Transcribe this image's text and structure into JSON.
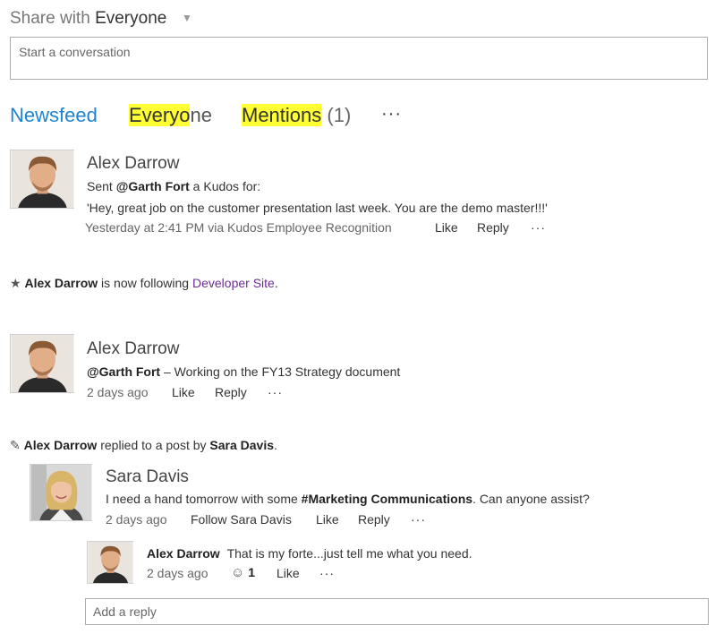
{
  "share": {
    "prefix": "Share with",
    "audience": "Everyone"
  },
  "composer": {
    "placeholder": "Start a conversation"
  },
  "tabs": {
    "newsfeed": "Newsfeed",
    "everyone_highlight": "Everyo",
    "everyone_rest": "ne",
    "mentions_highlight": "Mentions",
    "mentions_count": " (1)",
    "more": "···"
  },
  "posts": {
    "kudos": {
      "author": "Alex Darrow",
      "line1_pre": "Sent ",
      "line1_mention": "@Garth Fort",
      "line1_post": " a Kudos for:",
      "line2": "'Hey, great job on the customer presentation last week.  You are the demo master!!!'",
      "timestamp": "Yesterday at 2:41 PM via Kudos Employee Recognition",
      "like": "Like",
      "reply": "Reply",
      "more": "···"
    },
    "follow": {
      "actor": "Alex Darrow",
      "text": " is now following ",
      "target": "Developer Site",
      "end": "."
    },
    "strategy": {
      "author": "Alex Darrow",
      "mention": "@Garth Fort",
      "text": " – Working on the FY13 Strategy document",
      "timestamp": "2 days ago",
      "like": "Like",
      "reply": "Reply",
      "more": "···"
    },
    "replied": {
      "actor": "Alex Darrow",
      "text": " replied to a post by ",
      "target": "Sara Davis",
      "end": "."
    },
    "sara": {
      "author": "Sara Davis",
      "text_pre": "I need a hand tomorrow with some ",
      "hashtag": "#Marketing Communications",
      "text_post": ". Can anyone assist?",
      "timestamp": "2 days ago",
      "follow": "Follow Sara Davis",
      "like": "Like",
      "reply": "Reply",
      "more": "···"
    },
    "alex_reply": {
      "author": "Alex Darrow",
      "text": "That is my forte...just tell me what you need.",
      "timestamp": "2 days ago",
      "like_count": "1",
      "like": "Like",
      "more": "···"
    }
  },
  "reply_box": {
    "placeholder": "Add a reply"
  },
  "icons": {
    "share_caret": "chevron-down-icon",
    "follow": "star-icon",
    "replied": "pencil-icon",
    "smiley": "smiley-icon"
  },
  "colors": {
    "accent": "#1e83d0",
    "highlight": "#ffff33",
    "link_purple": "#6b2c94"
  }
}
